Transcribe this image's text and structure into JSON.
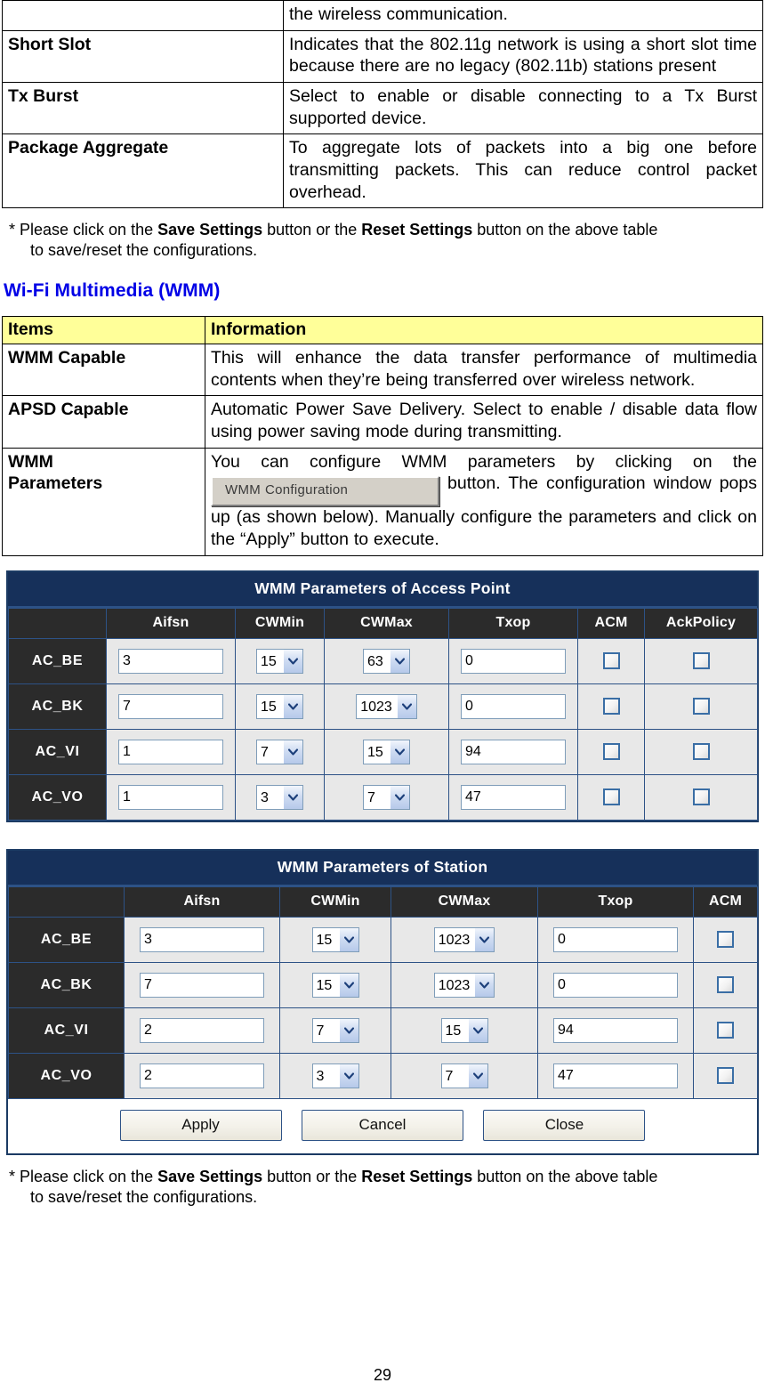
{
  "table_continued": {
    "rows": [
      {
        "item": "",
        "info": "the wireless communication."
      },
      {
        "item": "Short Slot",
        "info": "Indicates that the 802.11g network is using a short slot time because there are no legacy (802.11b) stations present"
      },
      {
        "item": "Tx Burst",
        "info": "Select to enable or disable connecting to a Tx Burst supported device."
      },
      {
        "item": "Package Aggregate",
        "info": "To aggregate lots of packets into a big one before transmitting packets. This can reduce control packet overhead."
      }
    ]
  },
  "note_top": {
    "prefix": "* Please click on the ",
    "bold1": "Save Settings",
    "mid": " button or the ",
    "bold2": "Reset Settings",
    "suffix": " button on the above table",
    "line2": "to save/reset the configurations."
  },
  "section": {
    "heading": "Wi-Fi Multimedia (WMM)",
    "heading_color": "#0000E6"
  },
  "table_wmm": {
    "header": {
      "items": "Items",
      "information": "Information",
      "bg": "#FFFF99"
    },
    "rows": [
      {
        "item": "WMM Capable",
        "info": "This will enhance the data transfer performance of multimedia contents when they’re being transferred over wireless network."
      },
      {
        "item": "APSD Capable",
        "info": "Automatic Power Save Delivery. Select to enable / disable data flow using power saving mode during transmitting."
      }
    ],
    "wmm_parameters": {
      "item": "WMM Parameters",
      "item_line1": "WMM",
      "item_line2": "Parameters",
      "text_before": "You can configure WMM parameters by clicking on the",
      "button_label": "WMM Configuration",
      "text_after": "button. The configuration window pops up (as shown below). Manually configure the parameters and click on the “Apply” button to execute."
    }
  },
  "panel_ap": {
    "title": "WMM Parameters of Access Point",
    "columns": [
      "",
      "Aifsn",
      "CWMin",
      "CWMax",
      "Txop",
      "ACM",
      "AckPolicy"
    ],
    "rows": [
      {
        "ac": "AC_BE",
        "aifsn": "3",
        "cwmin": "15",
        "cwmax": "63",
        "txop": "0",
        "acm": false,
        "ackpolicy": false
      },
      {
        "ac": "AC_BK",
        "aifsn": "7",
        "cwmin": "15",
        "cwmax": "1023",
        "txop": "0",
        "acm": false,
        "ackpolicy": false
      },
      {
        "ac": "AC_VI",
        "aifsn": "1",
        "cwmin": "7",
        "cwmax": "15",
        "txop": "94",
        "acm": false,
        "ackpolicy": false
      },
      {
        "ac": "AC_VO",
        "aifsn": "1",
        "cwmin": "3",
        "cwmax": "7",
        "txop": "47",
        "acm": false,
        "ackpolicy": false
      }
    ]
  },
  "panel_sta": {
    "title": "WMM Parameters of Station",
    "columns": [
      "",
      "Aifsn",
      "CWMin",
      "CWMax",
      "Txop",
      "ACM"
    ],
    "rows": [
      {
        "ac": "AC_BE",
        "aifsn": "3",
        "cwmin": "15",
        "cwmax": "1023",
        "txop": "0",
        "acm": false
      },
      {
        "ac": "AC_BK",
        "aifsn": "7",
        "cwmin": "15",
        "cwmax": "1023",
        "txop": "0",
        "acm": false
      },
      {
        "ac": "AC_VI",
        "aifsn": "2",
        "cwmin": "7",
        "cwmax": "15",
        "txop": "94",
        "acm": false
      },
      {
        "ac": "AC_VO",
        "aifsn": "2",
        "cwmin": "3",
        "cwmax": "7",
        "txop": "47",
        "acm": false
      }
    ],
    "buttons": {
      "apply": "Apply",
      "cancel": "Cancel",
      "close": "Close"
    }
  },
  "note_bottom": {
    "prefix": "* Please click on the ",
    "bold1": "Save Settings",
    "mid": " button or the ",
    "bold2": "Reset Settings",
    "suffix": " button on the above table",
    "line2": "to save/reset the configurations."
  },
  "page_number": "29",
  "colors": {
    "panel_title_bg": "#16305a",
    "panel_header_bg": "#2b2b2b",
    "panel_border": "#2d5286",
    "cell_bg": "#e8e8e8",
    "heading_blue": "#0000E6",
    "table_header_yellow": "#FFFF99"
  }
}
